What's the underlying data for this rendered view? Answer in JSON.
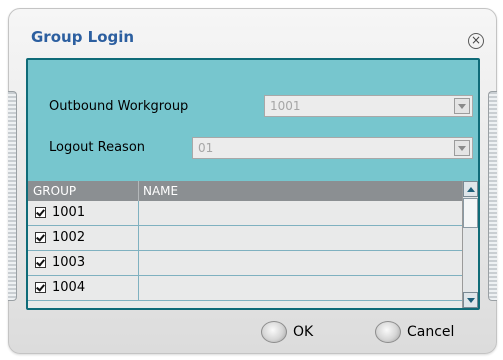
{
  "dialog": {
    "title": "Group Login",
    "close_icon": "close-circle-icon"
  },
  "form": {
    "workgroup_label": "Outbound Workgroup",
    "workgroup_value": "1001",
    "reason_label": "Logout Reason",
    "reason_value": "01"
  },
  "table": {
    "columns": [
      "GROUP",
      "NAME"
    ],
    "rows": [
      {
        "group": "1001",
        "name": "",
        "checked": true
      },
      {
        "group": "1002",
        "name": "",
        "checked": true
      },
      {
        "group": "1003",
        "name": "",
        "checked": true
      },
      {
        "group": "1004",
        "name": "",
        "checked": true
      }
    ]
  },
  "buttons": {
    "ok": "OK",
    "cancel": "Cancel"
  },
  "colors": {
    "panel": "#77c6ce",
    "panel_border": "#0f6b78",
    "title": "#2c5fa0",
    "header": "#8b8f92"
  }
}
